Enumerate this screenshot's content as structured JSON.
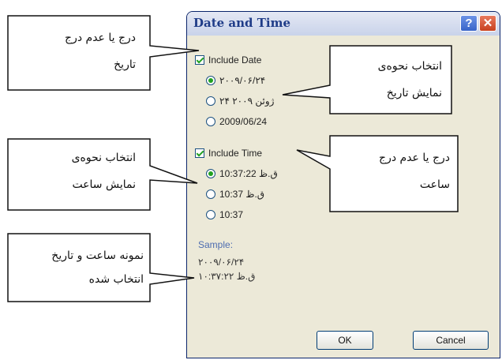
{
  "dialog": {
    "title": "Date and Time",
    "help_label": "?",
    "close_label": "✕",
    "include_date_label": "Include Date",
    "date_formats": [
      "۲۰۰۹/۰۶/۲۴",
      "۲۴ ژوئن ۲۰۰۹",
      "2009/06/24"
    ],
    "date_selected_index": 0,
    "include_time_label": "Include Time",
    "time_formats": [
      "10:37:22 ق.ظ",
      "10:37 ق.ظ",
      "10:37"
    ],
    "time_selected_index": 0,
    "sample_label": "Sample:",
    "sample_line1": "۲۰۰۹/۰۶/۲۴",
    "sample_line2": "۱۰:۳۷:۲۲ ق.ظ",
    "ok_label": "OK",
    "cancel_label": "Cancel"
  },
  "callouts": {
    "include_date": {
      "line1": "درج یا عدم درج",
      "line2": "تاریخ"
    },
    "date_format": {
      "line1": "انتخاب نحوه‌ی",
      "line2": "نمایش تاریخ"
    },
    "time_format": {
      "line1": "انتخاب نحوه‌ی",
      "line2": "نمایش ساعت"
    },
    "include_time": {
      "line1": "درج یا عدم درج",
      "line2": "ساعت"
    },
    "sample": {
      "line1": "نمونه ساعت و تاریخ",
      "line2": "انتخاب شده"
    }
  },
  "colors": {
    "title_bar": "#c9d3ea",
    "dialog_bg": "#ECE9D8",
    "check_green": "#21a121"
  }
}
